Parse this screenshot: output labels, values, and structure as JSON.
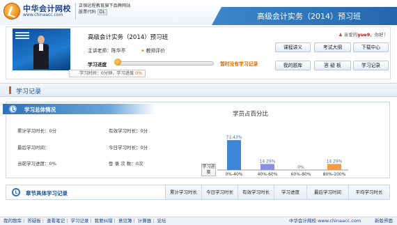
{
  "header": {
    "logo_name": "中华会计网校",
    "logo_url": "www.chinaacc.com",
    "slogan": "正保远程教育旗下品牌网站",
    "stock_label": "股票代码",
    "stock_code": "DL",
    "banner_title": "高级会计实务（2014）预习班"
  },
  "course": {
    "title": "高级会计实务（2014）预习班",
    "teacher_label": "主讲老师：陈华亭",
    "rate_link": "教师评价",
    "progress_label": "学习进度",
    "progress_fraction": 0,
    "no_record_text": "暂时没有学习记录",
    "time_tip_prefix": "学习时间：0分钟，学习进度",
    "time_tip_pct": "0%",
    "welcome_prefix": "亲爱的",
    "welcome_user": "yue9",
    "welcome_suffix": "，你好！",
    "buttons": [
      "课程讲义",
      "考试大纲",
      "下载中心",
      "我的题库",
      "答 疑 板",
      "学习记录"
    ]
  },
  "records": {
    "section_title": "学习记录",
    "summary_title": "学习总体情况",
    "stats": {
      "total_time": "累计学习时长：0分",
      "effective_time": "有效学习时长：0分",
      "last_time": "最后学习时间：",
      "today_time": "今日学习时长：0分",
      "current_progress": "当前学习进度：0%",
      "login_count": "登  录  次  数：0次"
    }
  },
  "chart_data": {
    "type": "bar",
    "title": "学员占百分比",
    "xlabel": "学习进度",
    "categories": [
      "0%-40%",
      "40%-60%",
      "60%-80%",
      "80%-100%"
    ],
    "values": [
      71.43,
      14.29,
      0,
      14.29
    ],
    "value_labels": [
      "71.43%",
      "14.29%",
      "0%",
      "14.29%"
    ],
    "colors": [
      "#3e86d6",
      "#8a8fe0",
      "#8a8fe0",
      "#f39b45"
    ],
    "ylim": [
      0,
      100
    ]
  },
  "chapters": {
    "title": "章节具体学习记录",
    "columns": [
      "累计学习时长",
      "今日学习时长",
      "有效学习时长",
      "学习进度",
      "最后学习时间",
      "平均学习时长"
    ]
  },
  "footer": {
    "links": [
      "我的题库",
      "答疑板",
      "查看笔记",
      "学习记录",
      "我要纠错",
      "意见簿",
      "计算器",
      "论坛"
    ],
    "brand": "中华会计网校 www.chinaacc.com",
    "version": "新版界面"
  }
}
